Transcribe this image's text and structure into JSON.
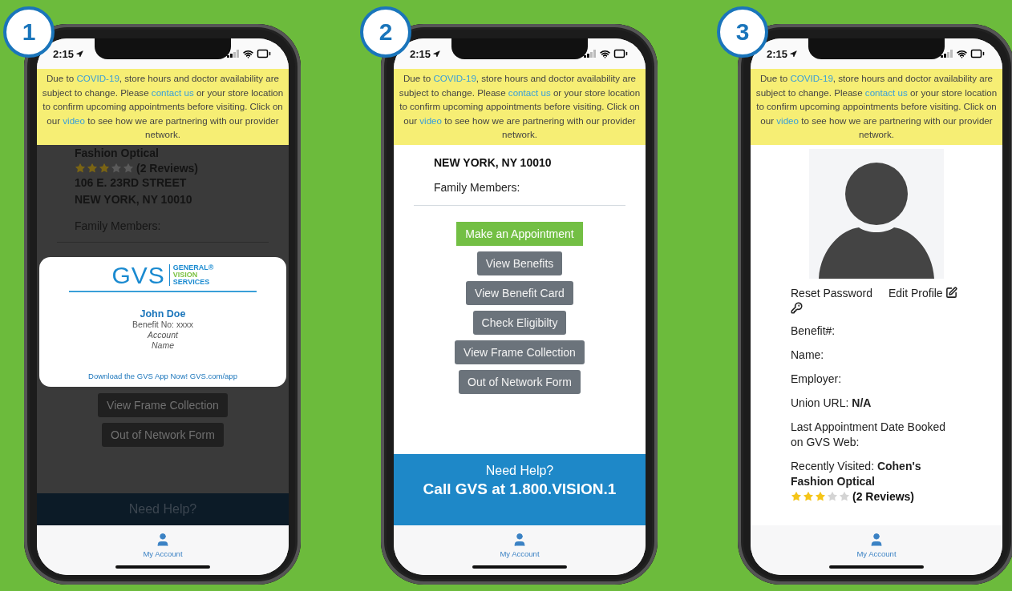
{
  "phones": [
    {
      "badge": "1",
      "kind": "card_overlay",
      "dimmed": true,
      "time": "2:15",
      "banner": [
        {
          "text": "Due to ",
          "link": false
        },
        {
          "text": "COVID-19",
          "link": true
        },
        {
          "text": ", store hours and doctor availability are subject to change. Please ",
          "link": false
        },
        {
          "text": "contact us",
          "link": true
        },
        {
          "text": " or your store location to confirm upcoming appointments before visiting. Click on our ",
          "link": false
        },
        {
          "text": "video",
          "link": true
        },
        {
          "text": " to see how we are partnering with our provider network.",
          "link": false
        }
      ],
      "store": {
        "name": "Fashion Optical",
        "stars": 3,
        "reviews": "(2 Reviews)",
        "address": [
          "106 E. 23RD STREET",
          "NEW YORK, NY 10010"
        ]
      },
      "family_label": "Family Members:",
      "card": {
        "logo": "GVS",
        "logo_lines": [
          {
            "text": "GENERAL®",
            "color": "#1a8ad0"
          },
          {
            "text": "VISION",
            "color": "#7cc242"
          },
          {
            "text": "SERVICES",
            "color": "#1a8ad0"
          }
        ],
        "member": "John Doe",
        "details": [
          {
            "text": "Benefit No: xxxx",
            "italic": false
          },
          {
            "text": "Account",
            "italic": true
          },
          {
            "text": "Name",
            "italic": true
          }
        ],
        "footer": "Download the GVS App Now! GVS.com/app"
      },
      "buttons": [
        {
          "label": "View Frame Collection",
          "kind": "secondary"
        },
        {
          "label": "Out of Network Form",
          "kind": "secondary"
        }
      ],
      "help": {
        "title": "Need Help?"
      },
      "tabs": [
        {
          "label": "My Account",
          "selected": true
        }
      ]
    },
    {
      "badge": "2",
      "kind": "menu",
      "dimmed": false,
      "time": "2:15",
      "banner": [
        {
          "text": "Due to ",
          "link": false
        },
        {
          "text": "COVID-19",
          "link": true
        },
        {
          "text": ", store hours and doctor availability are subject to change. Please ",
          "link": false
        },
        {
          "text": "contact us",
          "link": true
        },
        {
          "text": " or your store location to confirm upcoming appointments before visiting. Click on our ",
          "link": false
        },
        {
          "text": "video",
          "link": true
        },
        {
          "text": " to see how we are partnering with our provider network.",
          "link": false
        }
      ],
      "address": "NEW YORK, NY 10010",
      "family_label": "Family Members:",
      "buttons": [
        {
          "label": "Make an Appointment",
          "kind": "primary"
        },
        {
          "label": "View Benefits",
          "kind": "secondary"
        },
        {
          "label": "View Benefit Card",
          "kind": "secondary"
        },
        {
          "label": "Check Eligibilty",
          "kind": "secondary"
        },
        {
          "label": "View Frame Collection",
          "kind": "secondary"
        },
        {
          "label": "Out of Network Form",
          "kind": "secondary"
        }
      ],
      "help": {
        "title": "Need Help?",
        "phone": "Call GVS at 1.800.VISION.1"
      },
      "tabs": [
        {
          "label": "My Account",
          "selected": true
        }
      ]
    },
    {
      "badge": "3",
      "kind": "profile",
      "dimmed": false,
      "time": "2:15",
      "banner": [
        {
          "text": "Due to ",
          "link": false
        },
        {
          "text": "COVID-19",
          "link": true
        },
        {
          "text": ", store hours and doctor availability are subject to change. Please ",
          "link": false
        },
        {
          "text": "contact us",
          "link": true
        },
        {
          "text": " or your store location to confirm upcoming appointments before visiting. Click on our ",
          "link": false
        },
        {
          "text": "video",
          "link": true
        },
        {
          "text": " to see how we are partnering with our provider network.",
          "link": false
        }
      ],
      "actions": [
        "Reset Password",
        "Edit Profile"
      ],
      "fields": [
        "Benefit#:",
        "Name:",
        "Employer:",
        "Union URL: **N/A**",
        "Last Appointment Date Booked on GVS Web:",
        "Recently Visited: **Cohen's Fashion Optical**"
      ],
      "rating": {
        "stars": 3,
        "reviews": "(2 Reviews)"
      },
      "tabs": [
        {
          "label": "My Account",
          "selected": true
        }
      ]
    }
  ]
}
